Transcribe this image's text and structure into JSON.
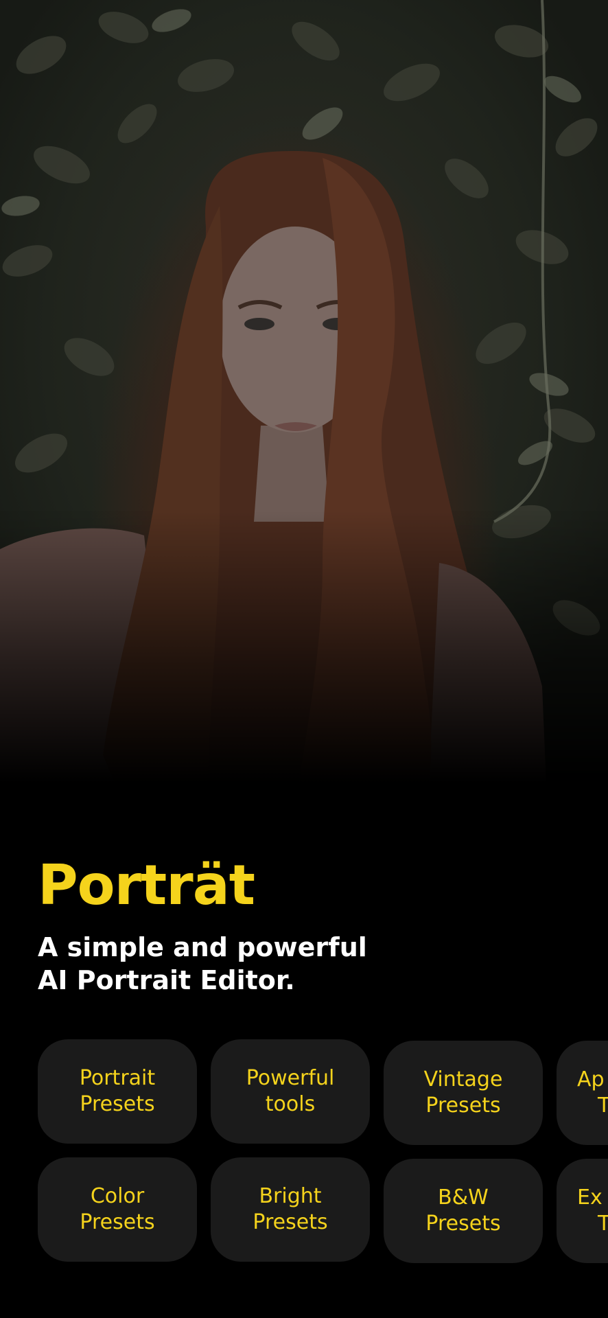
{
  "hero": {
    "image": "portrait-photo"
  },
  "app": {
    "title": "Porträt",
    "subtitle_line1": "A simple and powerful",
    "subtitle_line2": "AI Portrait Editor."
  },
  "chips": [
    {
      "line1": "Portrait",
      "line2": "Presets"
    },
    {
      "line1": "Powerful",
      "line2": "tools"
    },
    {
      "line1": "Vintage",
      "line2": "Presets"
    },
    {
      "line1": "Ap",
      "line2": "T"
    },
    {
      "line1": "Color",
      "line2": "Presets"
    },
    {
      "line1": "Bright",
      "line2": "Presets"
    },
    {
      "line1": "B&W",
      "line2": "Presets"
    },
    {
      "line1": "Ex",
      "line2": "T"
    }
  ],
  "colors": {
    "accent": "#f5d31c",
    "chip_background": "#1b1b1b",
    "background": "#000000"
  }
}
